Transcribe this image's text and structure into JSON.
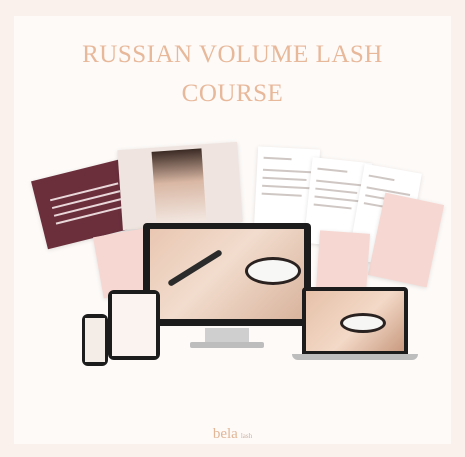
{
  "title": {
    "line1": "RUSSIAN VOLUME LASH",
    "line2": "COURSE"
  },
  "logo": {
    "brand": "bela",
    "suffix": "lash"
  },
  "colors": {
    "background": "#fbf1ec",
    "title": "#e8b89a",
    "accent_wine": "#6b2f3c"
  }
}
